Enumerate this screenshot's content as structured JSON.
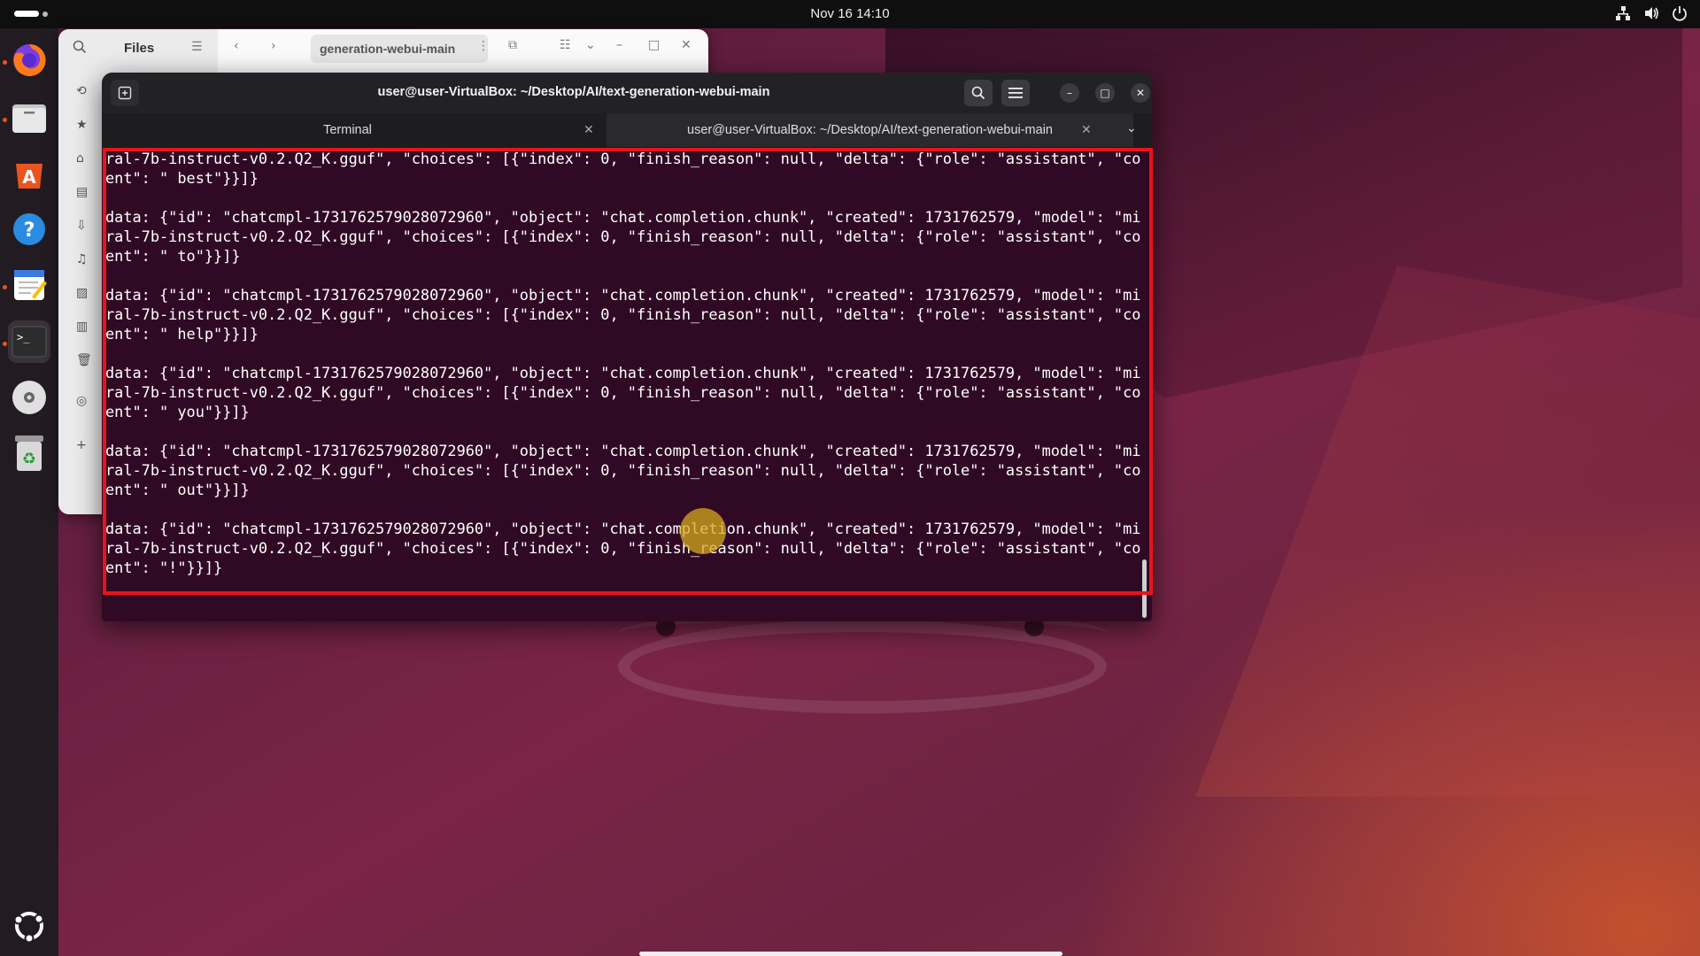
{
  "topbar": {
    "clock": "Nov 16  14:10",
    "icons": [
      "network-icon",
      "volume-icon",
      "power-icon"
    ]
  },
  "dock": {
    "items": [
      "firefox-icon",
      "files-icon",
      "app-center-icon",
      "help-icon",
      "text-editor-icon",
      "terminal-icon",
      "disc-icon",
      "trash-icon",
      "show-apps-icon"
    ]
  },
  "files": {
    "title": "Files",
    "path": "generation-webui-main"
  },
  "terminal": {
    "title": "user@user-VirtualBox: ~/Desktop/AI/text-generation-webui-main",
    "tabs": [
      {
        "label": "Terminal"
      },
      {
        "label": "user@user-VirtualBox: ~/Desktop/AI/text-generation-webui-main"
      }
    ],
    "lines": [
      "ral-7b-instruct-v0.2.Q2_K.gguf\", \"choices\": [{\"index\": 0, \"finish_reason\": null, \"delta\": {\"role\": \"assistant\", \"cont",
      "ent\": \" best\"}}]}",
      "",
      "data: {\"id\": \"chatcmpl-1731762579028072960\", \"object\": \"chat.completion.chunk\", \"created\": 1731762579, \"model\": \"mist",
      "ral-7b-instruct-v0.2.Q2_K.gguf\", \"choices\": [{\"index\": 0, \"finish_reason\": null, \"delta\": {\"role\": \"assistant\", \"cont",
      "ent\": \" to\"}}]}",
      "",
      "data: {\"id\": \"chatcmpl-1731762579028072960\", \"object\": \"chat.completion.chunk\", \"created\": 1731762579, \"model\": \"mist",
      "ral-7b-instruct-v0.2.Q2_K.gguf\", \"choices\": [{\"index\": 0, \"finish_reason\": null, \"delta\": {\"role\": \"assistant\", \"cont",
      "ent\": \" help\"}}]}",
      "",
      "data: {\"id\": \"chatcmpl-1731762579028072960\", \"object\": \"chat.completion.chunk\", \"created\": 1731762579, \"model\": \"mist",
      "ral-7b-instruct-v0.2.Q2_K.gguf\", \"choices\": [{\"index\": 0, \"finish_reason\": null, \"delta\": {\"role\": \"assistant\", \"cont",
      "ent\": \" you\"}}]}",
      "",
      "data: {\"id\": \"chatcmpl-1731762579028072960\", \"object\": \"chat.completion.chunk\", \"created\": 1731762579, \"model\": \"mist",
      "ral-7b-instruct-v0.2.Q2_K.gguf\", \"choices\": [{\"index\": 0, \"finish_reason\": null, \"delta\": {\"role\": \"assistant\", \"cont",
      "ent\": \" out\"}}]}",
      "",
      "data: {\"id\": \"chatcmpl-1731762579028072960\", \"object\": \"chat.completion.chunk\", \"created\": 1731762579, \"model\": \"mist",
      "ral-7b-instruct-v0.2.Q2_K.gguf\", \"choices\": [{\"index\": 0, \"finish_reason\": null, \"delta\": {\"role\": \"assistant\", \"cont",
      "ent\": \"!\"}}]}"
    ]
  },
  "colors": {
    "terminal_bg": "#300a24",
    "highlight": "#e8141c",
    "ubuntu_orange": "#e95420"
  }
}
